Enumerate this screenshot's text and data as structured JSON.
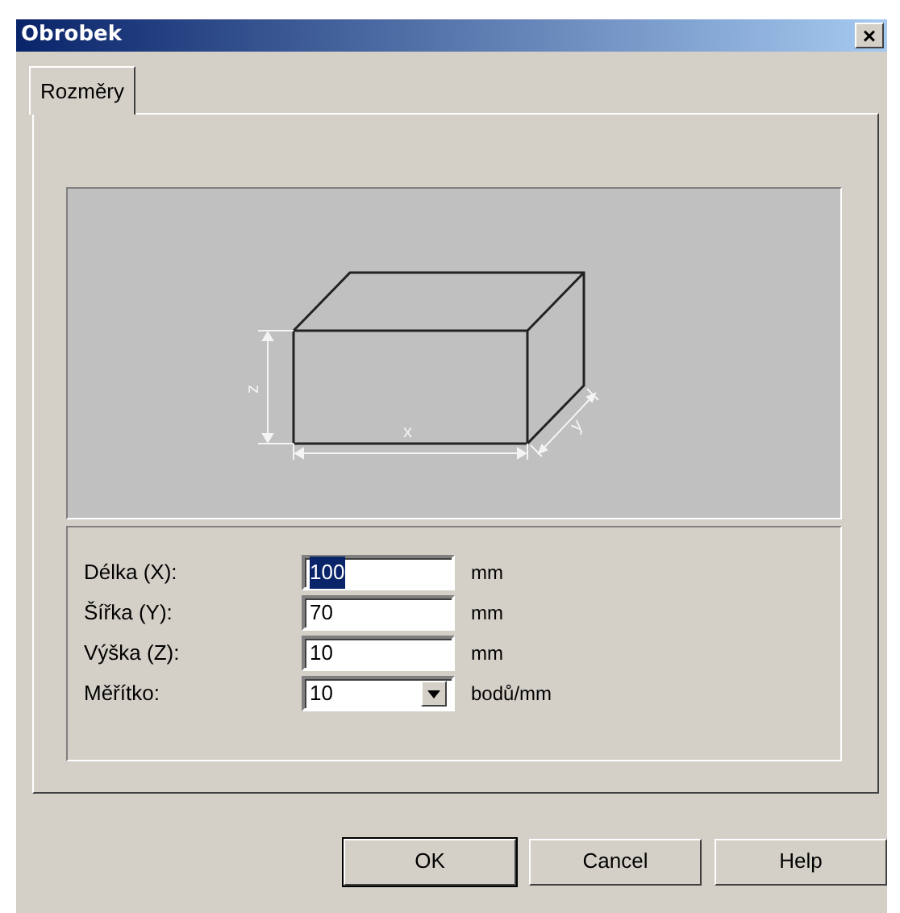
{
  "window": {
    "title": "Obrobek",
    "close": "×"
  },
  "tabs": [
    {
      "label": "Rozměry",
      "selected": true
    }
  ],
  "diagram": {
    "dimension_labels": {
      "x": "x",
      "y": "y",
      "z": "z"
    }
  },
  "fields": [
    {
      "kind": "text",
      "label": "Délka (X):",
      "value": "100",
      "text_selected": true,
      "unit": "mm"
    },
    {
      "kind": "text",
      "label": "Šířka (Y):",
      "value": "70",
      "text_selected": false,
      "unit": "mm"
    },
    {
      "kind": "text",
      "label": "Výška (Z):",
      "value": "10",
      "text_selected": false,
      "unit": "mm"
    },
    {
      "kind": "dropdown",
      "label": "Měřítko:",
      "value": "10",
      "text_selected": false,
      "unit": "bodů/mm"
    }
  ],
  "buttons": [
    {
      "label": "OK",
      "default": true
    },
    {
      "label": "Cancel",
      "default": false
    },
    {
      "label": "Help",
      "default": false
    }
  ]
}
